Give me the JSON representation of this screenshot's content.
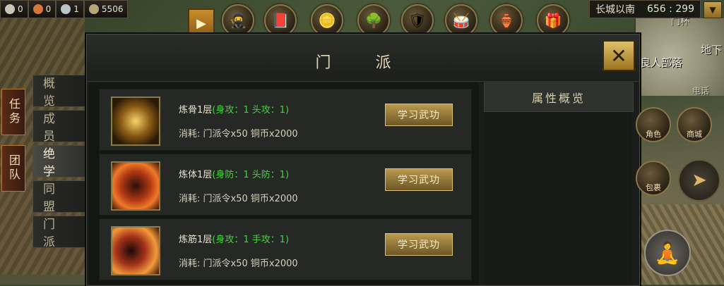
{
  "resources": [
    {
      "name": "silver-ingot",
      "value": "0",
      "color": "#c9c6b8"
    },
    {
      "name": "coin",
      "value": "0",
      "color": "#d6763a"
    },
    {
      "name": "gem",
      "value": "1",
      "color": "#b9c4cc"
    },
    {
      "name": "gold-pile",
      "value": "5506",
      "color": "#b6a778"
    }
  ],
  "location": {
    "name": "长城以南",
    "coords": "656 : 299"
  },
  "map_labels": [
    "地下",
    "良人部落",
    "门杯",
    "电话"
  ],
  "left_tabs": [
    "任务",
    "团队"
  ],
  "dialog": {
    "title": "门 派",
    "close_icon": "✕",
    "side_tabs": [
      "概览",
      "成员",
      "绝学",
      "同盟",
      "门派"
    ],
    "active_side_tab": 2,
    "overview_title": "属性概览",
    "skills": [
      {
        "name": "炼骨1层",
        "attr": "(身攻：1 头攻：1)",
        "cost": "消耗: 门派令x50 铜币x2000",
        "button": "学习武功",
        "icon": "fist-icon"
      },
      {
        "name": "炼体1层",
        "attr": "(身防：1 头防：1)",
        "cost": "消耗: 门派令x50 铜币x2000",
        "button": "学习武功",
        "icon": "body-icon"
      },
      {
        "name": "炼筋1层",
        "attr": "(身攻：1 手攻：1)",
        "cost": "消耗: 门派令x50 铜币x2000",
        "button": "学习武功",
        "icon": "arm-icon"
      }
    ]
  },
  "right_buttons": [
    {
      "label": "角色",
      "icon": "hat-icon"
    },
    {
      "label": "商城",
      "icon": "shop-icon"
    },
    {
      "label": "包裹",
      "icon": "bag-icon"
    }
  ]
}
